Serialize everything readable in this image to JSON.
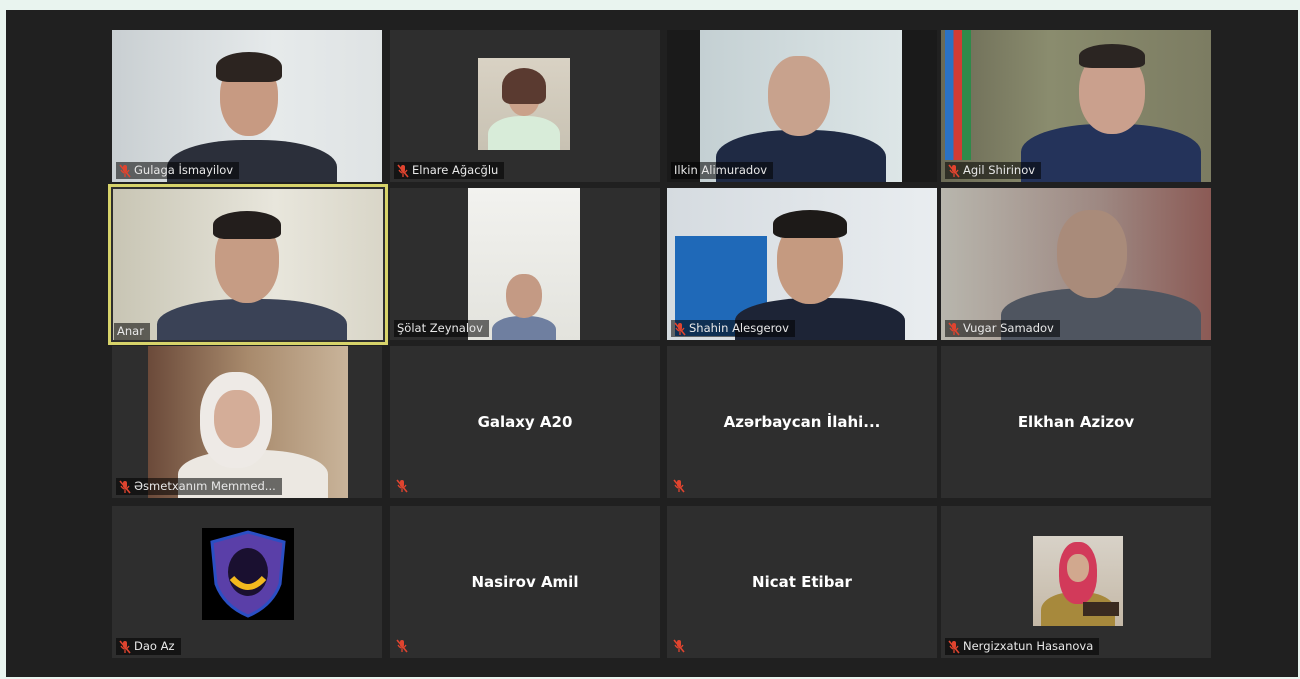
{
  "participants": [
    {
      "name": "Gulaga İsmayilov",
      "muted": true
    },
    {
      "name": "Elnare Ağacğlu",
      "muted": true
    },
    {
      "name": "Ilkin Alimuradov",
      "muted": false
    },
    {
      "name": "Agil Shirinov",
      "muted": true
    },
    {
      "name": "Anar",
      "muted": false
    },
    {
      "name": "Şölat Zeynalov",
      "muted": false
    },
    {
      "name": "Shahin Alesgerov",
      "muted": true
    },
    {
      "name": "Vugar Samadov",
      "muted": true
    },
    {
      "name": "Əsmetxanım Memmed...",
      "muted": true
    },
    {
      "name": "Galaxy A20",
      "muted": true
    },
    {
      "name": "Azərbaycan İlahi...",
      "muted": true
    },
    {
      "name": "Elkhan Azizov",
      "muted": false
    },
    {
      "name": "Dao Az",
      "muted": true
    },
    {
      "name": "Nasirov Amil",
      "muted": true
    },
    {
      "name": "Nicat Etibar",
      "muted": true
    },
    {
      "name": "Nergizxatun Hasanova",
      "muted": true
    }
  ],
  "colors": {
    "mute_icon": "#e0442f",
    "active_speaker_border": "#d7d36a",
    "tile_bg": "#2e2e2e"
  },
  "icons": {
    "mute": "mic-muted-icon"
  }
}
